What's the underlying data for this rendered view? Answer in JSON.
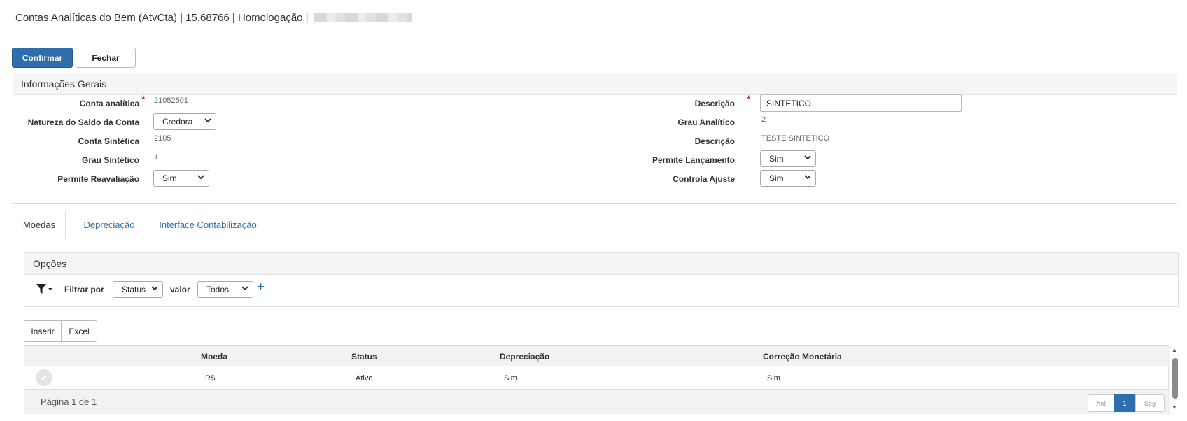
{
  "window": {
    "title": "Contas Analíticas do Bem (AtvCta) | 15.68766 | Homologação |"
  },
  "toolbar": {
    "confirm_label": "Confirmar",
    "close_label": "Fechar"
  },
  "general": {
    "title": "Informações Gerais",
    "left": {
      "conta_analitica_label": "Conta analítica",
      "conta_analitica_value": "21052501",
      "natureza_label": "Natureza do Saldo da Conta",
      "natureza_value": "Credora",
      "conta_sintetica_label": "Conta Sintética",
      "conta_sintetica_value": "2105",
      "grau_sintetico_label": "Grau Sintético",
      "grau_sintetico_value": "1",
      "permite_reavaliacao_label": "Permite Reavaliação",
      "permite_reavaliacao_value": "Sim"
    },
    "right": {
      "descricao_label": "Descrição",
      "descricao_value": "SINTETICO",
      "grau_analitico_label": "Grau Analítico",
      "grau_analitico_value": "2",
      "descricao2_label": "Descrição",
      "descricao2_value": "TESTE SINTETICO",
      "permite_lancamento_label": "Permite Lançamento",
      "permite_lancamento_value": "Sim",
      "controla_ajuste_label": "Controla Ajuste",
      "controla_ajuste_value": "Sim"
    },
    "required_mark": "*"
  },
  "tabs": [
    {
      "label": "Moedas",
      "active": true
    },
    {
      "label": "Depreciação",
      "active": false
    },
    {
      "label": "Interface Contabilização",
      "active": false
    }
  ],
  "options": {
    "title": "Opções",
    "filter_label": "Filtrar por",
    "filter_field": "Status",
    "value_label": "valor",
    "value_field": "Todos",
    "add_icon": "+"
  },
  "grid_actions": {
    "insert_label": "Inserir",
    "excel_label": "Excel"
  },
  "grid": {
    "columns": [
      "Moeda",
      "Status",
      "Depreciação",
      "Correção Monetária"
    ],
    "rows": [
      [
        "R$",
        "Ativo",
        "Sim",
        "Sim"
      ]
    ],
    "page_info": "Página 1 de 1",
    "pager": {
      "prev": "Ant",
      "current": "1",
      "next": "Seg"
    }
  },
  "colors": {
    "primary": "#2f6eac",
    "link": "#2a6fb0",
    "required": "#d9292b"
  }
}
